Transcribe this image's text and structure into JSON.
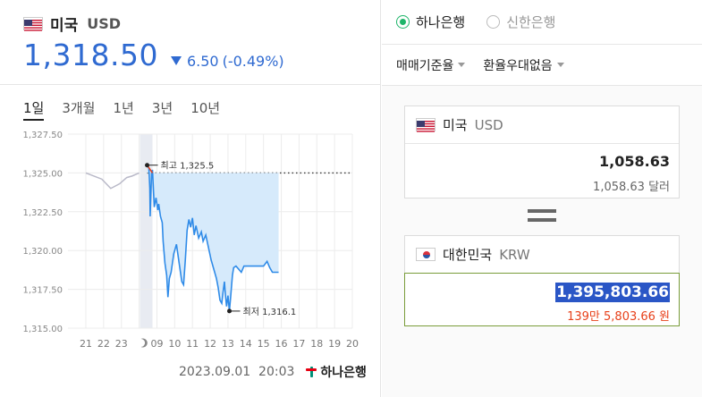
{
  "left": {
    "currency_name": "미국",
    "currency_code": "USD",
    "price": "1,318.50",
    "change": "6.50",
    "change_pct": "(-0.49%)",
    "periods": [
      "1일",
      "3개월",
      "1년",
      "3년",
      "10년"
    ],
    "active_period": "1일",
    "timestamp": "2023.09.01  20:03",
    "bank_logo": "하나은행"
  },
  "chart_data": {
    "type": "area",
    "x_ticks": [
      "21",
      "22",
      "23",
      "moon-icon",
      "09",
      "10",
      "11",
      "12",
      "13",
      "14",
      "15",
      "16",
      "17",
      "18",
      "19",
      "20"
    ],
    "y_ticks": [
      "1,327.50",
      "1,325.00",
      "1,322.50",
      "1,320.00",
      "1,317.50",
      "1,315.00"
    ],
    "ylim": [
      1315.0,
      1327.5
    ],
    "reference_line": 1325.0,
    "high": {
      "label": "최고 1,325.5",
      "value": 1325.5
    },
    "low": {
      "label": "최저 1,316.1",
      "value": 1316.1
    },
    "series": [
      {
        "name": "overnight",
        "points": [
          [
            0,
            1325.0
          ],
          [
            0.9,
            1324.6
          ],
          [
            1.4,
            1324.0
          ],
          [
            1.9,
            1324.3
          ],
          [
            2.3,
            1324.7
          ],
          [
            2.6,
            1324.8
          ],
          [
            3.0,
            1325.0
          ]
        ]
      },
      {
        "name": "today",
        "points": [
          [
            3.45,
            1325.5
          ],
          [
            3.55,
            1325.3
          ],
          [
            3.6,
            1324.0
          ],
          [
            3.62,
            1322.2
          ],
          [
            3.7,
            1325.0
          ],
          [
            3.75,
            1325.2
          ],
          [
            3.85,
            1322.8
          ],
          [
            3.95,
            1323.4
          ],
          [
            4.05,
            1322.6
          ],
          [
            4.1,
            1323.0
          ],
          [
            4.2,
            1322.2
          ],
          [
            4.3,
            1321.8
          ],
          [
            4.35,
            1320.6
          ],
          [
            4.45,
            1319.2
          ],
          [
            4.55,
            1318.4
          ],
          [
            4.62,
            1317.0
          ],
          [
            4.7,
            1318.2
          ],
          [
            4.8,
            1318.6
          ],
          [
            4.95,
            1319.8
          ],
          [
            5.1,
            1320.4
          ],
          [
            5.25,
            1319.2
          ],
          [
            5.4,
            1318.0
          ],
          [
            5.5,
            1317.8
          ],
          [
            5.6,
            1319.4
          ],
          [
            5.7,
            1321.3
          ],
          [
            5.8,
            1322.0
          ],
          [
            5.9,
            1321.5
          ],
          [
            6.0,
            1322.1
          ],
          [
            6.1,
            1321.0
          ],
          [
            6.2,
            1321.6
          ],
          [
            6.35,
            1320.8
          ],
          [
            6.5,
            1321.2
          ],
          [
            6.6,
            1320.6
          ],
          [
            6.75,
            1321.0
          ],
          [
            6.9,
            1320.2
          ],
          [
            7.05,
            1319.4
          ],
          [
            7.2,
            1318.8
          ],
          [
            7.35,
            1318.2
          ],
          [
            7.45,
            1317.6
          ],
          [
            7.55,
            1316.8
          ],
          [
            7.65,
            1316.6
          ],
          [
            7.72,
            1317.3
          ],
          [
            7.8,
            1318.0
          ],
          [
            7.85,
            1317.2
          ],
          [
            7.92,
            1316.4
          ],
          [
            8.0,
            1317.1
          ],
          [
            8.08,
            1316.1
          ],
          [
            8.15,
            1317.0
          ],
          [
            8.25,
            1318.4
          ],
          [
            8.32,
            1318.9
          ],
          [
            8.45,
            1319.0
          ],
          [
            8.6,
            1318.8
          ],
          [
            8.75,
            1318.6
          ],
          [
            8.9,
            1319.0
          ],
          [
            9.2,
            1319.0
          ],
          [
            9.6,
            1319.0
          ],
          [
            10.0,
            1319.0
          ],
          [
            10.2,
            1319.3
          ],
          [
            10.35,
            1318.9
          ],
          [
            10.5,
            1318.6
          ],
          [
            10.7,
            1318.6
          ],
          [
            10.85,
            1318.6
          ]
        ]
      }
    ]
  },
  "right": {
    "banks": [
      "하나은행",
      "신한은행"
    ],
    "selected_bank": "하나은행",
    "rate_type": "매매기준율",
    "discount": "환율우대없음",
    "from": {
      "name": "미국",
      "code": "USD",
      "amount": "1,058.63",
      "amount_text": "1,058.63 달러"
    },
    "to": {
      "name": "대한민국",
      "code": "KRW",
      "amount": "1,395,803.66",
      "amount_text": "139만 5,803.66 원"
    }
  },
  "colors": {
    "accent_blue": "#2f6ad1",
    "fill_blue": "#d6eafb",
    "selected_green": "#1fb56a",
    "red_text": "#e8411b"
  }
}
